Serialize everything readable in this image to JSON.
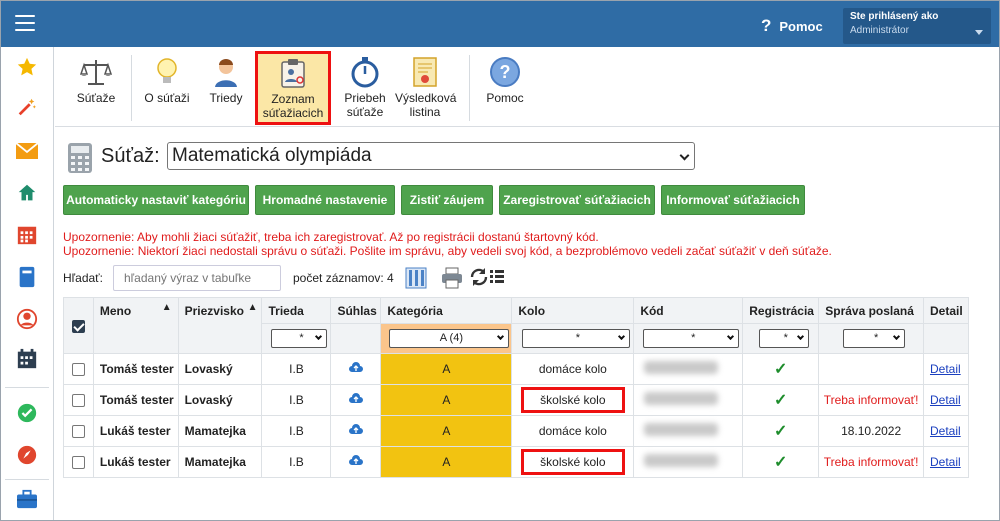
{
  "topbar": {
    "help_label": "Pomoc",
    "user_line1": "Ste prihlásený ako",
    "user_line2": "Administrátor"
  },
  "toolbar": {
    "items": [
      {
        "label": "Súťaže",
        "icon": "scales-icon"
      },
      {
        "label": "O súťaži",
        "icon": "lightbulb-icon"
      },
      {
        "label": "Triedy",
        "icon": "student-icon"
      },
      {
        "label": "Zoznam súťažiacich",
        "icon": "clipboard-list-icon"
      },
      {
        "label": "Priebeh súťaže",
        "icon": "stopwatch-icon"
      },
      {
        "label": "Výsledková listina",
        "icon": "certificate-icon"
      },
      {
        "label": "Pomoc",
        "icon": "help-icon"
      }
    ]
  },
  "competition": {
    "label": "Súťaž:",
    "selected": "Matematická olympiáda"
  },
  "actions": [
    "Automaticky nastaviť kategóriu",
    "Hromadné nastavenie",
    "Zistiť záujem",
    "Zaregistrovať súťažiacich",
    "Informovať súťažiacich"
  ],
  "warnings": [
    "Upozornenie: Aby mohli žiaci súťažiť, treba ich zaregistrovať. Až po registrácii dostanú štartovný kód.",
    "Upozornenie: Niektorí žiaci nedostali správu o súťaži. Pošlite im správu, aby vedeli svoj kód, a bezproblémovo vedeli začať súťažiť v deň súťaže."
  ],
  "search": {
    "label": "Hľadať:",
    "placeholder": "hľadaný výraz v tabuľke",
    "count_label": "počet záznamov: 4"
  },
  "table": {
    "headers": [
      "Meno",
      "Priezvisko",
      "Trieda",
      "Súhlas",
      "Kategória",
      "Kolo",
      "Kód",
      "Registrácia",
      "Správa poslaná",
      "Detail"
    ],
    "filters": {
      "trieda": "*",
      "kategoria": "A (4)",
      "kolo": "*",
      "kod": "*",
      "registracia": "*",
      "sprava": "*"
    },
    "rows": [
      {
        "meno": "Tomáš tester",
        "priezvisko": "Lovaský",
        "trieda": "I.B",
        "kategoria": "A",
        "kolo": "domáce kolo",
        "registracia": "✓",
        "sprava": "",
        "detail": "Detail"
      },
      {
        "meno": "Tomáš tester",
        "priezvisko": "Lovaský",
        "trieda": "I.B",
        "kategoria": "A",
        "kolo": "školské kolo",
        "registracia": "✓",
        "sprava": "Treba informovať!",
        "detail": "Detail"
      },
      {
        "meno": "Lukáš tester",
        "priezvisko": "Mamatejka",
        "trieda": "I.B",
        "kategoria": "A",
        "kolo": "domáce kolo",
        "registracia": "✓",
        "sprava": "18.10.2022",
        "detail": "Detail"
      },
      {
        "meno": "Lukáš tester",
        "priezvisko": "Mamatejka",
        "trieda": "I.B",
        "kategoria": "A",
        "kolo": "školské kolo",
        "registracia": "✓",
        "sprava": "Treba informovať!",
        "detail": "Detail"
      }
    ]
  },
  "colors": {
    "topbar": "#2f6ca5",
    "button_green": "#4fa34d",
    "category_yellow": "#f2c311",
    "warning_red": "#e01b1b",
    "highlight_red": "#ee1111"
  }
}
